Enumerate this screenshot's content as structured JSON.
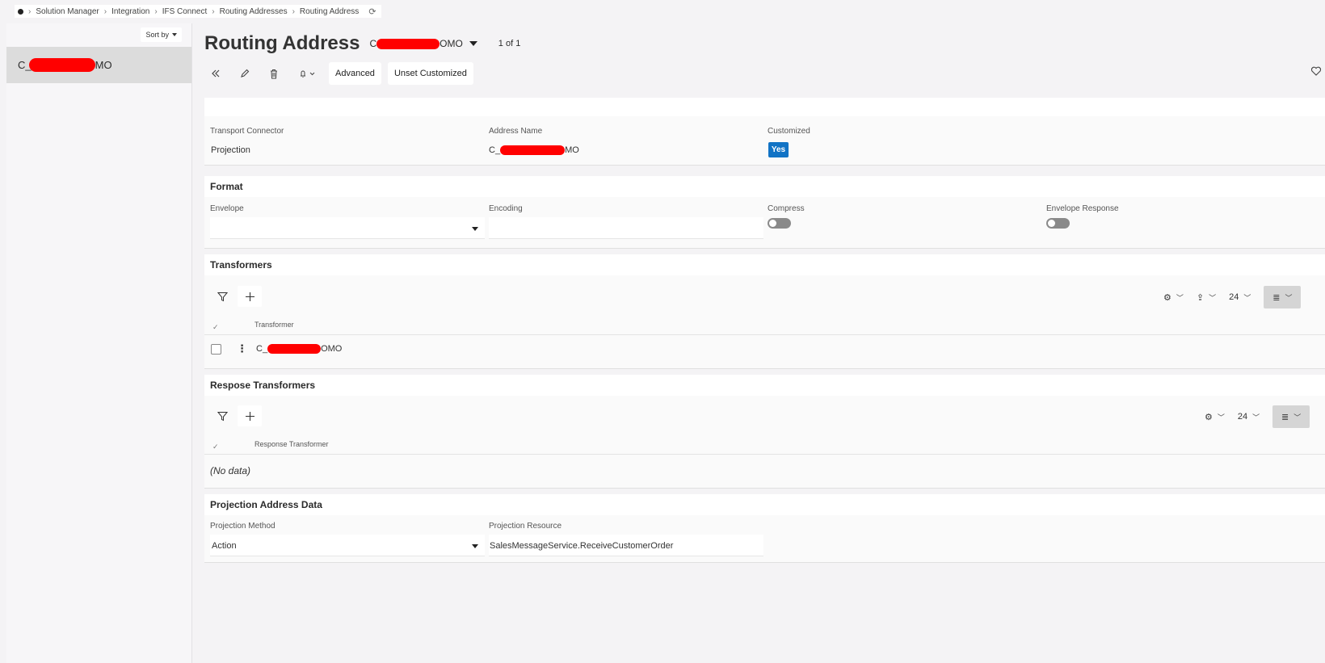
{
  "breadcrumb": {
    "items": [
      "Solution Manager",
      "Integration",
      "IFS Connect",
      "Routing Addresses",
      "Routing Address"
    ]
  },
  "left_panel": {
    "sort_label": "Sort by",
    "items": [
      {
        "prefix": "C_",
        "suffix": "MO"
      }
    ]
  },
  "header": {
    "title": "Routing Address",
    "key_prefix": "C",
    "key_suffix": "OMO",
    "pager": "1 of 1"
  },
  "toolbar": {
    "advanced_label": "Advanced",
    "unset_customized_label": "Unset Customized"
  },
  "general": {
    "transport_connector_label": "Transport Connector",
    "transport_connector_value": "Projection",
    "address_name_label": "Address Name",
    "address_name_prefix": "C_",
    "address_name_suffix": "MO",
    "customized_label": "Customized",
    "customized_value": "Yes"
  },
  "format": {
    "title": "Format",
    "envelope_label": "Envelope",
    "envelope_value": "",
    "encoding_label": "Encoding",
    "encoding_value": "",
    "compress_label": "Compress",
    "compress_on": false,
    "envelope_response_label": "Envelope Response",
    "envelope_response_on": false
  },
  "transformers": {
    "title": "Transformers",
    "page_size": "24",
    "column": "Transformer",
    "rows": [
      {
        "prefix": "C_",
        "suffix": "OMO"
      }
    ]
  },
  "response_transformers": {
    "title": "Respose Transformers",
    "page_size": "24",
    "column": "Response Transformer",
    "empty_text": "(No data)"
  },
  "projection": {
    "title": "Projection Address Data",
    "method_label": "Projection Method",
    "method_value": "Action",
    "resource_label": "Projection Resource",
    "resource_value": "SalesMessageService.ReceiveCustomerOrder"
  },
  "colors": {
    "accent": "#1173c5",
    "redaction": "#ff0000"
  }
}
